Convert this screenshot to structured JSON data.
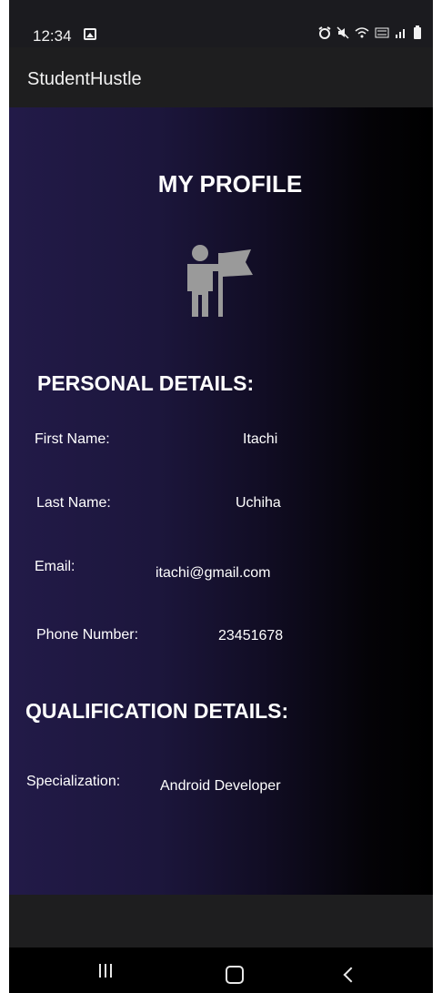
{
  "status_bar": {
    "time": "12:34",
    "icons": [
      "gallery-icon",
      "alarm-icon",
      "mute-icon",
      "wifi-icon",
      "volte-icon",
      "signal-icon",
      "battery-icon"
    ]
  },
  "app_bar": {
    "title": "StudentHustle"
  },
  "profile": {
    "title": "MY PROFILE",
    "avatar_icon": "person-with-flag-icon",
    "personal_heading": "PERSONAL DETAILS:",
    "fields": [
      {
        "label": "First Name:",
        "value": "Itachi"
      },
      {
        "label": "Last Name:",
        "value": "Uchiha"
      },
      {
        "label": "Email:",
        "value": "itachi@gmail.com"
      },
      {
        "label": "Phone Number:",
        "value": "23451678"
      }
    ],
    "qualification_heading": "QUALIFICATION DETAILS:",
    "qualification": {
      "label": "Specialization:",
      "value": "Android Developer"
    }
  },
  "colors": {
    "content_gradient_start": "#221a48",
    "content_gradient_end": "#000000",
    "app_bar": "#1e1e1f",
    "text": "#ffffff"
  },
  "nav_bar": {
    "buttons": [
      "recent-apps",
      "home",
      "back"
    ]
  }
}
